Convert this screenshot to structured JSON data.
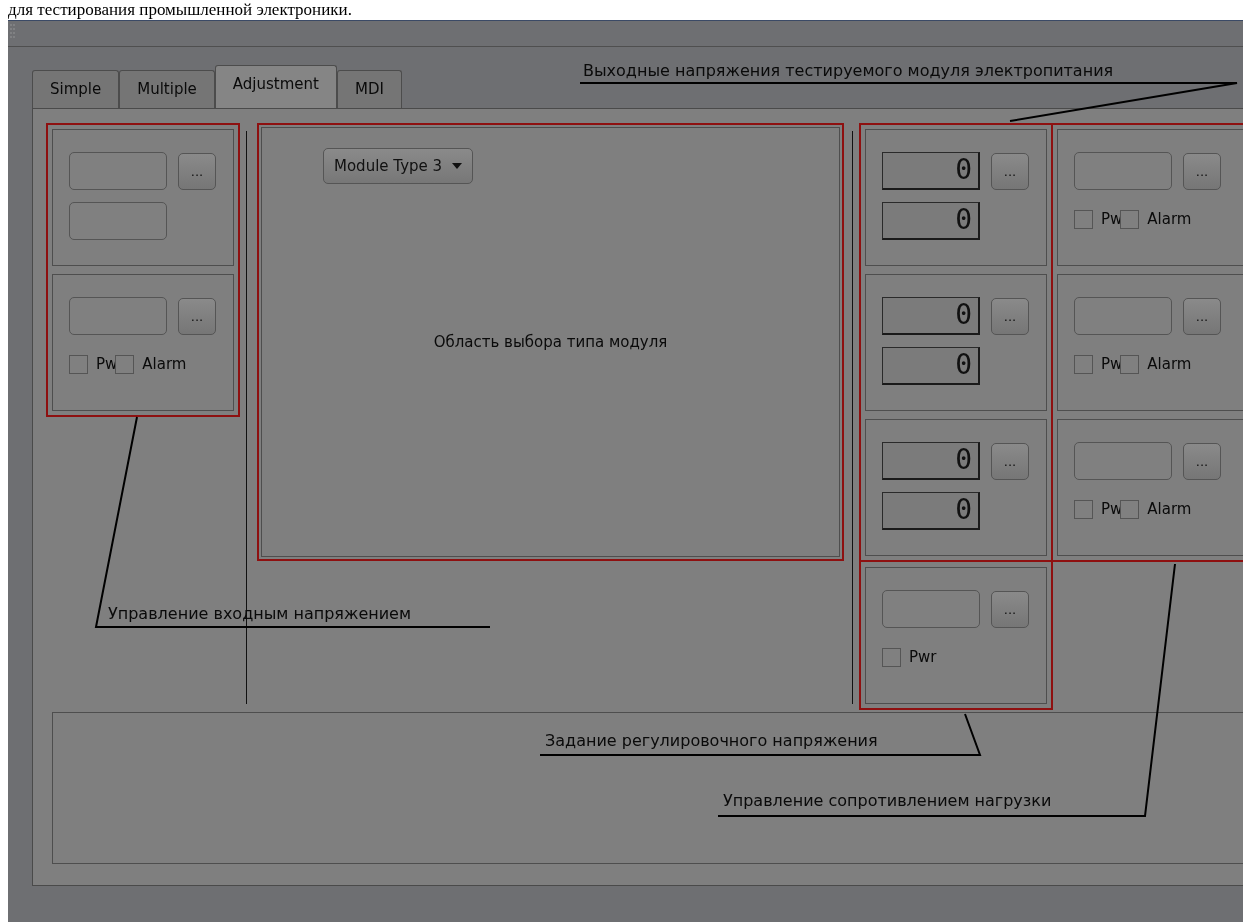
{
  "document_text": "для тестирования промышленной электроники.",
  "tabs": [
    {
      "label": "Simple",
      "selected": false
    },
    {
      "label": "Multiple",
      "selected": false
    },
    {
      "label": "Adjustment",
      "selected": true
    },
    {
      "label": "MDI",
      "selected": false
    }
  ],
  "input_control": [
    {
      "kind": "fields",
      "button": "..."
    },
    {
      "kind": "checks",
      "button": "...",
      "checks": [
        {
          "label": "Pw",
          "checked": false
        },
        {
          "label": "Alarm",
          "checked": false
        }
      ]
    }
  ],
  "module_select": {
    "dropdown": "Module Type 3",
    "caption": "Область выбора типа модуля"
  },
  "output_voltages": [
    {
      "kind": "lcd",
      "button": "...",
      "readings": [
        "0",
        "0"
      ]
    },
    {
      "kind": "lcd",
      "button": "...",
      "readings": [
        "0",
        "0"
      ]
    },
    {
      "kind": "lcd",
      "button": "...",
      "readings": [
        "0",
        "0"
      ]
    }
  ],
  "load_control": [
    {
      "kind": "checks",
      "button": "...",
      "checks": [
        {
          "label": "Pw",
          "checked": false
        },
        {
          "label": "Alarm",
          "checked": false
        }
      ]
    },
    {
      "kind": "checks",
      "button": "...",
      "checks": [
        {
          "label": "Pw",
          "checked": false
        },
        {
          "label": "Alarm",
          "checked": false
        }
      ]
    },
    {
      "kind": "checks",
      "button": "...",
      "checks": [
        {
          "label": "Pw",
          "checked": false
        },
        {
          "label": "Alarm",
          "checked": false
        }
      ]
    }
  ],
  "adjustment_voltage": [
    {
      "kind": "checks",
      "button": "...",
      "checks": [
        {
          "label": "Pwr",
          "checked": false
        }
      ]
    }
  ],
  "annotations": [
    {
      "text": "Выходные напряжения тестируемого модуля электропитания"
    },
    {
      "text": "Управление входным напряжением"
    },
    {
      "text": "Задание регулировочного напряжения"
    },
    {
      "text": "Управление сопротивлением нагрузки"
    }
  ]
}
